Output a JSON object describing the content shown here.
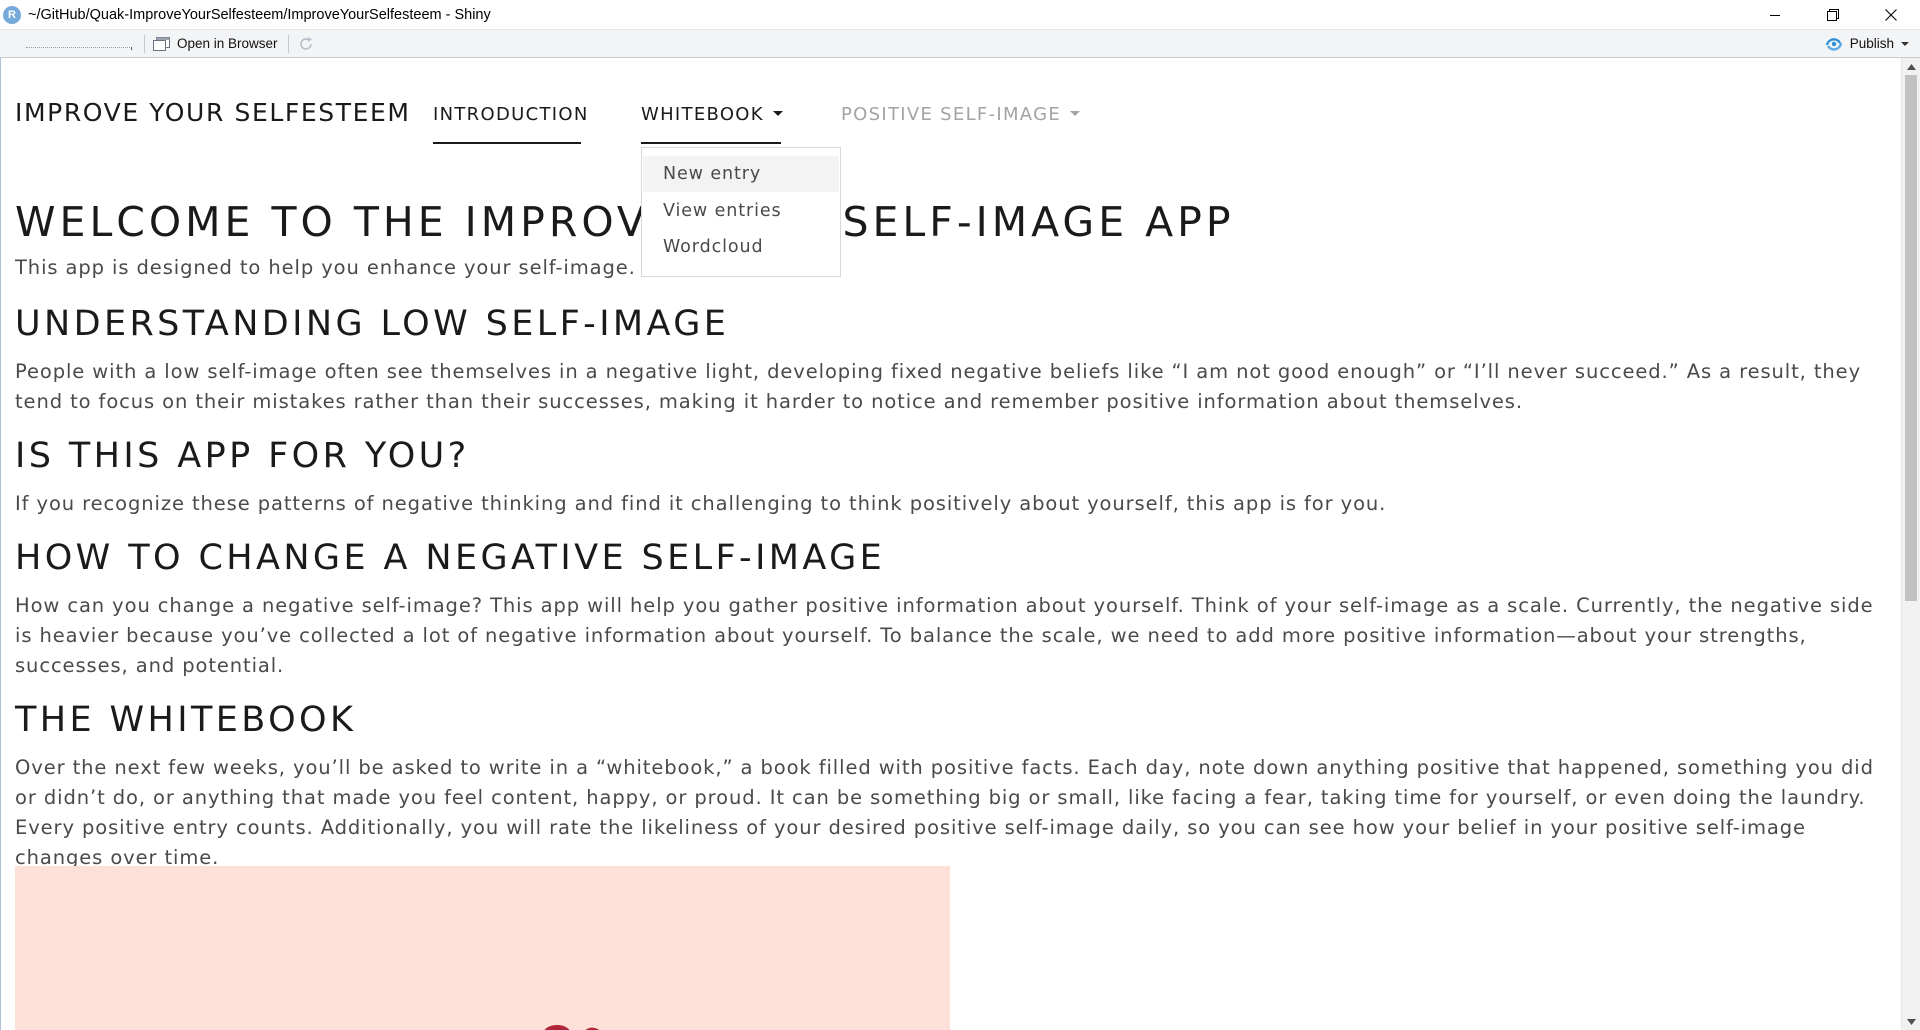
{
  "window": {
    "title": "~/GitHub/Quak-ImproveYourSelfesteem/ImproveYourSelfesteem - Shiny",
    "app_icon_letter": "R"
  },
  "toolbar": {
    "open_in_browser": "Open in Browser",
    "publish": "Publish"
  },
  "navbar": {
    "brand": "IMPROVE YOUR SELFESTEEM",
    "items": [
      {
        "label": "INTRODUCTION",
        "active": true
      },
      {
        "label": "WHITEBOOK",
        "has_dropdown": true
      },
      {
        "label": "POSITIVE SELF-IMAGE",
        "has_dropdown": true,
        "muted": true
      }
    ]
  },
  "dropdown": {
    "items": [
      "New entry",
      "View entries",
      "Wordcloud"
    ],
    "highlighted": "New entry"
  },
  "main": {
    "title": "WELCOME TO THE IMPROVE YOUR SELF-IMAGE APP",
    "intro": "This app is designed to help you enhance your self-image.",
    "sections": [
      {
        "heading": "UNDERSTANDING LOW SELF-IMAGE",
        "text": "People with a low self-image often see themselves in a negative light, developing fixed negative beliefs like “I am not good enough” or “I’ll never succeed.” As a result, they tend to focus on their mistakes rather than their successes, making it harder to notice and remember positive information about themselves."
      },
      {
        "heading": "IS THIS APP FOR YOU?",
        "text": "If you recognize these patterns of negative thinking and find it challenging to think positively about yourself, this app is for you."
      },
      {
        "heading": "HOW TO CHANGE A NEGATIVE SELF-IMAGE",
        "text": "How can you change a negative self-image? This app will help you gather positive information about yourself. Think of your self-image as a scale. Currently, the negative side is heavier because you’ve collected a lot of negative information about yourself. To balance the scale, we need to add more positive information—about your strengths, successes, and potential."
      },
      {
        "heading": "THE WHITEBOOK",
        "text": "Over the next few weeks, you’ll be asked to write in a “whitebook,” a book filled with positive facts. Each day, note down anything positive that happened, something you did or didn’t do, or anything that made you feel content, happy, or proud. It can be something big or small, like facing a fear, taking time for yourself, or even doing the laundry. Every positive entry counts. Additionally, you will rate the likeliness of your desired positive self-image daily, so you can see how your belief in your positive self-image changes over time."
      }
    ]
  },
  "colors": {
    "text_dark": "#1a1a1a",
    "text_body": "#4a4a4a",
    "nav_muted": "#a3a3a3",
    "illustration_bg": "#fde0d8",
    "illustration_accent": "#b0253a",
    "publish_icon": "#2f8fd8"
  },
  "icons": {
    "open_in_browser": "browser-window-icon",
    "refresh": "refresh-icon",
    "publish": "publish-icon",
    "minimize": "minimize-icon",
    "restore": "restore-icon",
    "close": "close-icon"
  }
}
